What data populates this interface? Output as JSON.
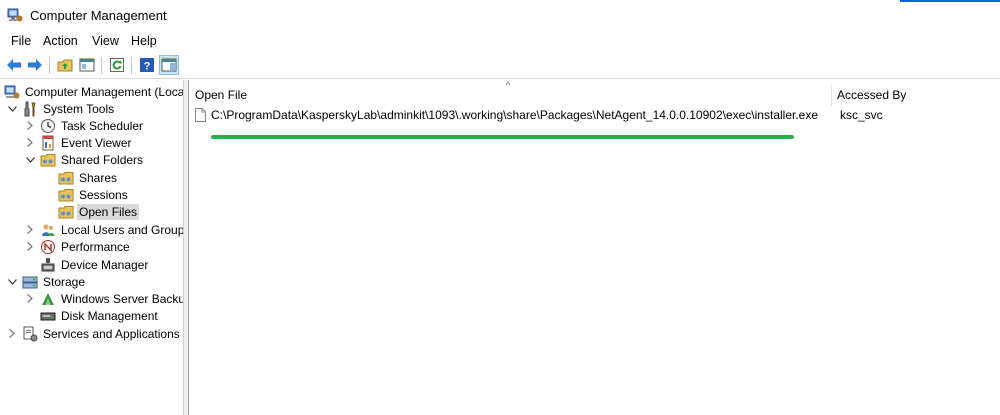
{
  "window": {
    "title": "Computer Management"
  },
  "menu": {
    "items": [
      "File",
      "Action",
      "View",
      "Help"
    ]
  },
  "tree": {
    "items": [
      {
        "label": "Computer Management (Local",
        "icon": "computer-management-icon"
      },
      {
        "label": "System Tools",
        "icon": "system-tools-icon"
      },
      {
        "label": "Task Scheduler",
        "icon": "clock-icon"
      },
      {
        "label": "Event Viewer",
        "icon": "event-viewer-icon"
      },
      {
        "label": "Shared Folders",
        "icon": "shared-folder-icon"
      },
      {
        "label": "Shares",
        "icon": "shared-folder-icon"
      },
      {
        "label": "Sessions",
        "icon": "shared-folder-icon"
      },
      {
        "label": "Open Files",
        "icon": "shared-folder-icon"
      },
      {
        "label": "Local Users and Groups",
        "icon": "users-icon"
      },
      {
        "label": "Performance",
        "icon": "performance-icon"
      },
      {
        "label": "Device Manager",
        "icon": "device-manager-icon"
      },
      {
        "label": "Storage",
        "icon": "storage-icon"
      },
      {
        "label": "Windows Server Backup",
        "icon": "backup-icon"
      },
      {
        "label": "Disk Management",
        "icon": "disk-icon"
      },
      {
        "label": "Services and Applications",
        "icon": "services-icon"
      }
    ]
  },
  "table": {
    "columns": [
      "Open File",
      "Accessed By"
    ],
    "rows": [
      {
        "file": "C:\\ProgramData\\KasperskyLab\\adminkit\\1093\\.working\\share\\Packages\\NetAgent_14.0.0.10902\\exec\\installer.exe",
        "user": "ksc_svc"
      }
    ]
  },
  "colors": {
    "highlight": "#22b14c",
    "selection": "#d9d9d9",
    "accent": "#0a64d8"
  }
}
